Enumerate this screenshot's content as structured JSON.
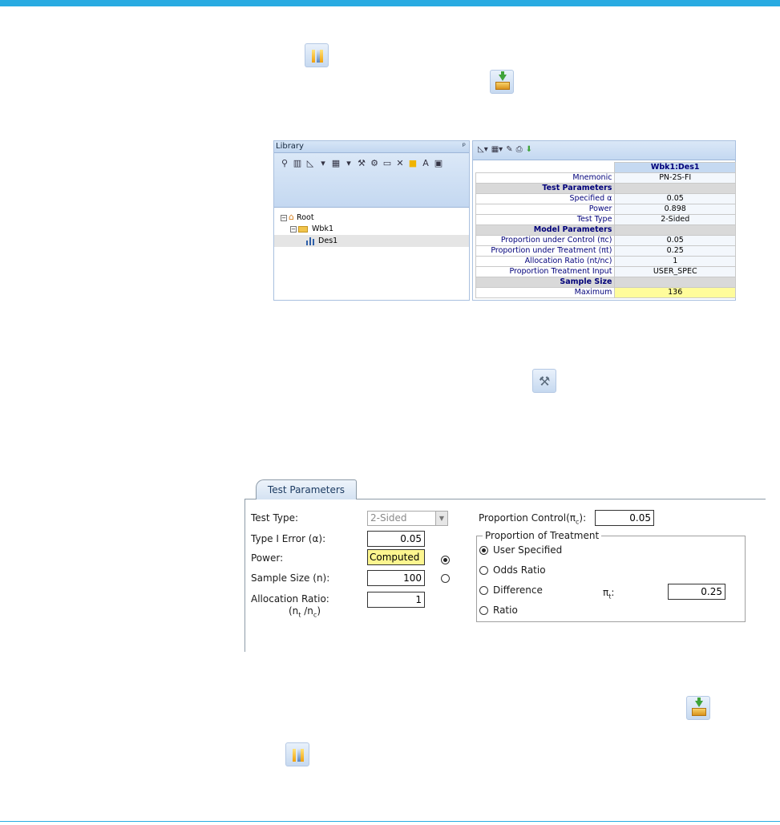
{
  "library": {
    "title": "Library",
    "pin": "ᵖ",
    "tree": {
      "root": "Root",
      "workbook": "Wbk1",
      "design": "Des1"
    }
  },
  "output": {
    "header": "Wbk1:Des1",
    "rows": [
      {
        "k": "Mnemonic",
        "v": "PN-2S-FI"
      },
      {
        "section": "Test Parameters"
      },
      {
        "k": "Specified α",
        "v": "0.05"
      },
      {
        "k": "Power",
        "v": "0.898"
      },
      {
        "k": "Test Type",
        "v": "2-Sided"
      },
      {
        "section": "Model Parameters"
      },
      {
        "k": "Proportion under Control (πc)",
        "v": "0.05"
      },
      {
        "k": "Proportion under Treatment (πt)",
        "v": "0.25"
      },
      {
        "k": "Allocation Ratio (nt/nc)",
        "v": "1"
      },
      {
        "k": "Proportion Treatment Input",
        "v": "USER_SPEC"
      },
      {
        "section": "Sample Size"
      },
      {
        "k": "Maximum",
        "v": "136",
        "highlight": true
      }
    ]
  },
  "form": {
    "tab": "Test Parameters",
    "test_type_label": "Test Type:",
    "test_type_value": "2-Sided",
    "type1_label": "Type I Error (α):",
    "type1_value": "0.05",
    "power_label": "Power:",
    "power_value": "Computed",
    "sample_label": "Sample Size (n):",
    "sample_value": "100",
    "alloc_label": "Allocation Ratio:",
    "alloc_value": "1",
    "alloc_sub_n1": "(n",
    "alloc_sub_t": "t",
    "alloc_sub_mid": " /n",
    "alloc_sub_c": "c",
    "alloc_sub_end": ")",
    "control_label": "Proportion Control(π",
    "control_sub": "c",
    "control_end": "):",
    "control_value": "0.05",
    "group_title": "Proportion of Treatment",
    "opt_user": "User Specified",
    "opt_odds": "Odds Ratio",
    "opt_diff": "Difference",
    "opt_ratio": "Ratio",
    "pi_t_label": "π",
    "pi_t_sub": "t",
    "pi_t_end": ":",
    "pi_t_value": "0.25"
  },
  "colors": {
    "accent": "#29abe2",
    "highlight": "#fffc9b",
    "computed": "#fcf58f"
  }
}
